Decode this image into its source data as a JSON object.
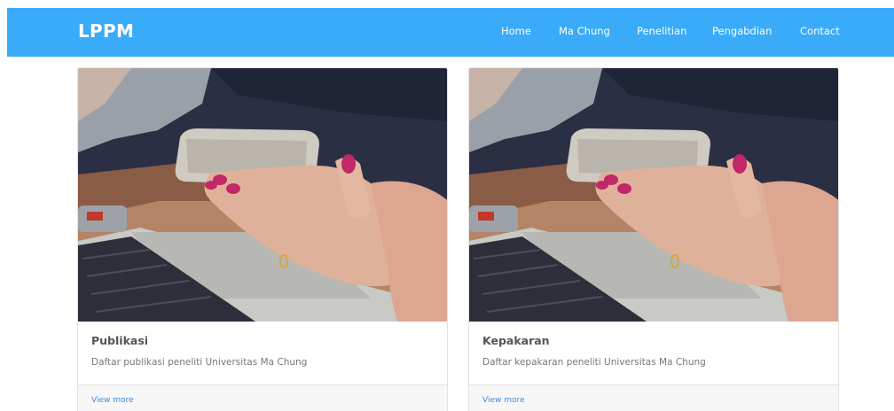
{
  "navbar": {
    "brand": "LPPM",
    "links": [
      "Home",
      "Ma Chung",
      "Penelitian",
      "Pengabdian",
      "Contact"
    ],
    "background_color": "#3aabf9"
  },
  "cards": [
    {
      "title": "Publikasi",
      "description": "Daftar publikasi peneliti Universitas Ma Chung",
      "link_label": "View more",
      "image": "photo-hand-holding-phone-over-laptop"
    },
    {
      "title": "Kepakaran",
      "description": "Daftar kepakaran peneliti Universitas Ma Chung",
      "link_label": "View more",
      "image": "photo-hand-holding-phone-over-laptop"
    }
  ]
}
